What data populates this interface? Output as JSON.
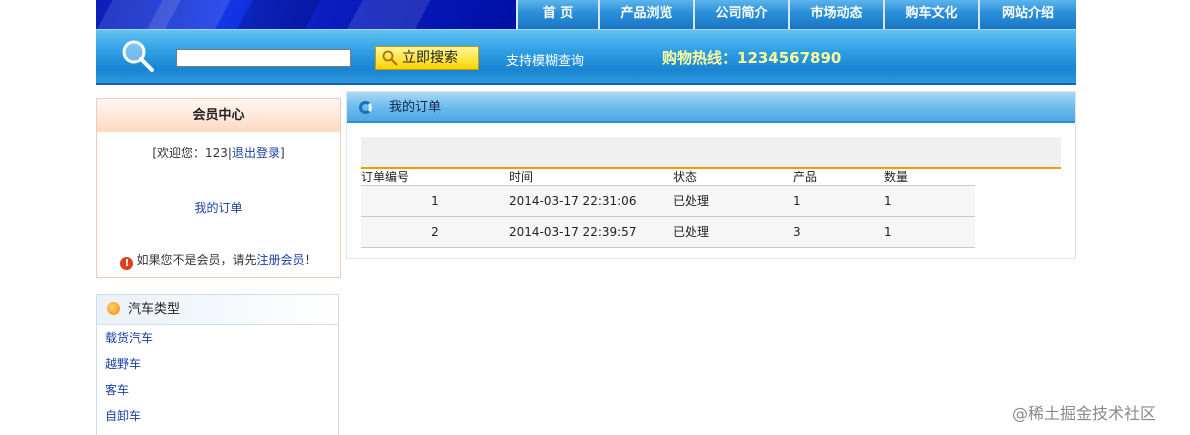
{
  "nav": {
    "items": [
      "首 页",
      "产品浏览",
      "公司简介",
      "市场动态",
      "购车文化",
      "网站介绍"
    ]
  },
  "search": {
    "placeholder": "",
    "button_label": "立即搜索",
    "fuzzy_label": "支持模糊查询",
    "hotline": "购物热线：1234567890"
  },
  "member": {
    "title": "会员中心",
    "welcome_prefix": "[欢迎您：123|",
    "logout": "退出登录",
    "welcome_suffix": "]",
    "my_orders": "我的订单",
    "notice_prefix": "如果您不是会员，请先",
    "register": "注册会员",
    "notice_suffix": "！"
  },
  "cartypes": {
    "title": "汽车类型",
    "items": [
      "载货汽车",
      "越野车",
      "客车",
      "自卸车"
    ]
  },
  "orders": {
    "title": "我的订单",
    "columns": [
      "订单编号",
      "时间",
      "状态",
      "产品",
      "数量"
    ],
    "rows": [
      [
        "1",
        "2014-03-17 22:31:06",
        "已处理",
        "1",
        "1"
      ],
      [
        "2",
        "2014-03-17 22:39:57",
        "已处理",
        "3",
        "1"
      ]
    ]
  },
  "watermark": "@稀土掘金技术社区",
  "colors": {
    "accent": "#2a8fd8",
    "hotline": "#fffb9a",
    "link": "#1a3ea6",
    "divider": "#f0a000"
  }
}
